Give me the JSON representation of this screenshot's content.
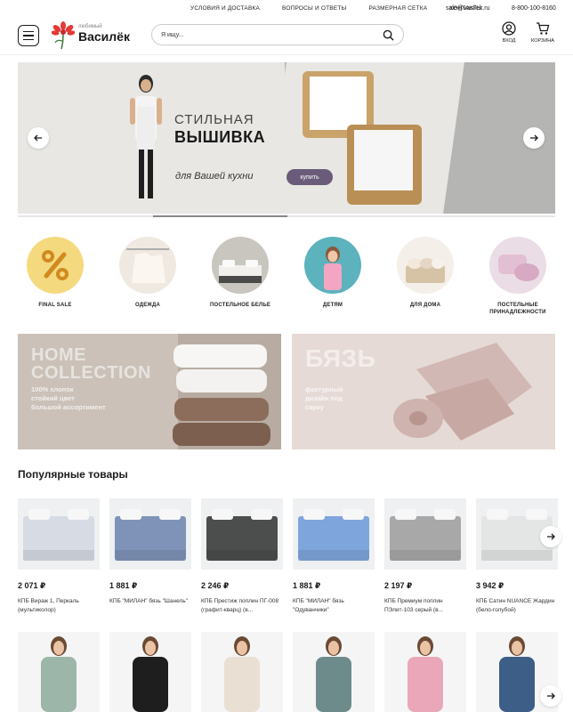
{
  "topbar": {
    "links": [
      "УСЛОВИЯ И ДОСТАВКА",
      "ВОПРОСЫ И ОТВЕТЫ",
      "РАЗМЕРНАЯ СЕТКА",
      "КОНТАКТЫ"
    ],
    "email": "sale@vasilek.ru",
    "phone": "8-800-100-8160"
  },
  "header": {
    "logo_small": "любимый",
    "logo_big": "Василёк",
    "search_placeholder": "Я ищу...",
    "login_label": "ВХОД",
    "cart_label": "КОРЗИНА"
  },
  "hero": {
    "title1": "СТИЛЬНАЯ",
    "title2": "ВЫШИВКА",
    "subtitle": "для Вашей кухни",
    "cta": "купить",
    "progress": 0.25
  },
  "categories": [
    {
      "label": "FINAL SALE",
      "color": "#f2c94c"
    },
    {
      "label": "ОДЕЖДА",
      "color": "#ece4da"
    },
    {
      "label": "ПОСТЕЛЬНОЕ БЕЛЬЕ",
      "color": "#9aa0a6"
    },
    {
      "label": "ДЕТЯМ",
      "color": "#5fb3bf"
    },
    {
      "label": "ДЛЯ ДОМА",
      "color": "#e7ddd0"
    },
    {
      "label": "ПОСТЕЛЬНЫЕ ПРИНАДЛЕЖНОСТИ",
      "color": "#ead9e6"
    }
  ],
  "promos": [
    {
      "big1": "HOME",
      "big2": "COLLECTION",
      "small": [
        "100% хлопок",
        "стойкий цвет",
        "большой ассортимент"
      ],
      "color": "#c9bfb6"
    },
    {
      "big1": "БЯЗЬ",
      "big2": "",
      "small": [
        "фактурный",
        "дизайн под",
        "сарку"
      ],
      "color": "#e8dcd8"
    }
  ],
  "popular": {
    "title": "Популярные товары",
    "items": [
      {
        "price": "2 071 ₽",
        "name": "КПБ Вираж 1, Перкаль (мультиколор)",
        "color": "#d6dbe4"
      },
      {
        "price": "1 881 ₽",
        "name": "КПБ \"МИЛАН\" бязь \"Шанель\"",
        "color": "#7f93b8"
      },
      {
        "price": "2 246 ₽",
        "name": "КПБ Престиж поплин ПГ-008 (графит-кварц) (в...",
        "color": "#4b4e4c"
      },
      {
        "price": "1 881 ₽",
        "name": "КПБ \"МИЛАН\" бязь \"Одуванчики\"",
        "color": "#7fa5dd"
      },
      {
        "price": "2 197 ₽",
        "name": "КПБ Премиум поплин ПЭлит-103 серый (в...",
        "color": "#a8a8a8"
      },
      {
        "price": "3 942 ₽",
        "name": "КПБ Сатин NUANCE Жардин (бело-голубой)",
        "color": "#e4e6e6"
      }
    ]
  },
  "second_row": [
    {
      "color": "#9cb6aa"
    },
    {
      "color": "#1e1e1e"
    },
    {
      "color": "#eadfd3"
    },
    {
      "color": "#6e8b8c"
    },
    {
      "color": "#e9a7b9"
    },
    {
      "color": "#3d5e86"
    }
  ]
}
